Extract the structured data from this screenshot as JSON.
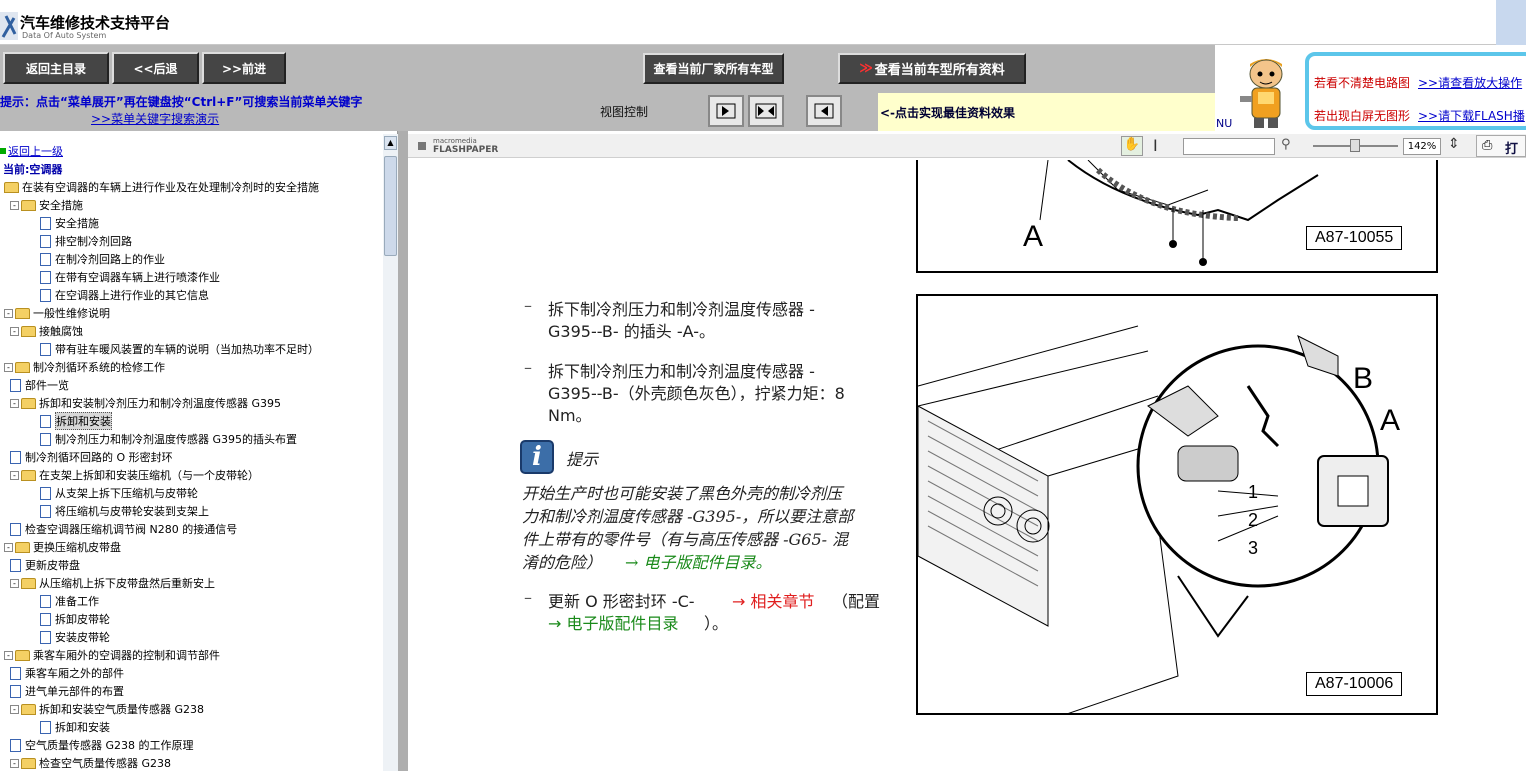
{
  "app": {
    "title": "汽车维修技术支持平台",
    "subtitle": "Data Of Auto System"
  },
  "toolbar": {
    "back_main": "返回主目录",
    "back": "<<后退",
    "forward": ">>前进",
    "all_models": "查看当前厂家所有车型",
    "all_data": "查看当前车型所有资料"
  },
  "hint": {
    "line1": "提示：点击“菜单展开”再在键盘按“Ctrl+F”可搜索当前菜单关键字",
    "line2": ">>菜单关键字搜索演示",
    "view_control": "视图控制",
    "best_effect": "<-点击实现最佳资料效果"
  },
  "ad": {
    "l1a": "若看不清楚电路图",
    "l1b": ">>请查看放大操作",
    "l2a": "若出现白屏无图形",
    "l2b": ">>请下载FLASH播",
    "nu": "NU"
  },
  "sidebar": {
    "back_up": "返回上一级",
    "current": "当前:空调器",
    "items": [
      "在装有空调器的车辆上进行作业及在处理制冷剂时的安全措施",
      "安全措施",
      "安全措施",
      "排空制冷剂回路",
      "在制冷剂回路上的作业",
      "在带有空调器车辆上进行喷漆作业",
      "在空调器上进行作业的其它信息",
      "一般性维修说明",
      "接触腐蚀",
      "带有驻车暖风装置的车辆的说明（当加热功率不足时）",
      "制冷剂循环系统的检修工作",
      "部件一览",
      "拆卸和安装制冷剂压力和制冷剂温度传感器 G395",
      "拆卸和安装",
      "制冷剂压力和制冷剂温度传感器 G395的插头布置",
      "制冷剂循环回路的 O 形密封环",
      "在支架上拆卸和安装压缩机（与一个皮带轮）",
      "从支架上拆下压缩机与皮带轮",
      "将压缩机与皮带轮安装到支架上",
      "检查空调器压缩机调节阀 N280 的接通信号",
      "更换压缩机皮带盘",
      "更新皮带盘",
      "从压缩机上拆下皮带盘然后重新安上",
      "准备工作",
      "拆卸皮带轮",
      "安装皮带轮",
      "乘客车厢外的空调器的控制和调节部件",
      "乘客车厢之外的部件",
      "进气单元部件的布置",
      "拆卸和安装空气质量传感器 G238",
      "拆卸和安装",
      "空气质量传感器 G238 的工作原理",
      "检查空气质量传感器 G238"
    ]
  },
  "flashpaper": {
    "brand": "macromedia",
    "product": "FLASHPAPER",
    "zoom": "142%",
    "print": "打"
  },
  "doc": {
    "step1_a": "拆下制冷剂压力和制冷剂温度传感器 -",
    "step1_b": "G395--B- 的插头 -A-。",
    "step2_a": "拆下制冷剂压力和制冷剂温度传感器 -",
    "step2_b": "G395--B-（外壳颜色灰色），拧紧力矩：8",
    "step2_c": "Nm。",
    "note_title": "提示",
    "note_l1": "开始生产时也可能安装了黑色外壳的制冷剂压",
    "note_l2": "力和制冷剂温度传感器 -G395-，所以要注意部",
    "note_l3": "件上带有的零件号（有与高压传感器 -G65- 混",
    "note_l4a": "淆的危险）",
    "note_l4b": "→ 电子版配件目录。",
    "step3_a": "更新 O 形密封环 -C-",
    "step3_link1": "→ 相关章节",
    "step3_b": "（配置",
    "step3_link2": "→ 电子版配件目录",
    "step3_c": "）。",
    "fig1_label": "A87-10055",
    "fig1_letter": "A",
    "fig2_label": "A87-10006",
    "fig2_B": "B",
    "fig2_A": "A",
    "fig2_n1": "1",
    "fig2_n2": "2",
    "fig2_n3": "3",
    "dash": "–"
  }
}
